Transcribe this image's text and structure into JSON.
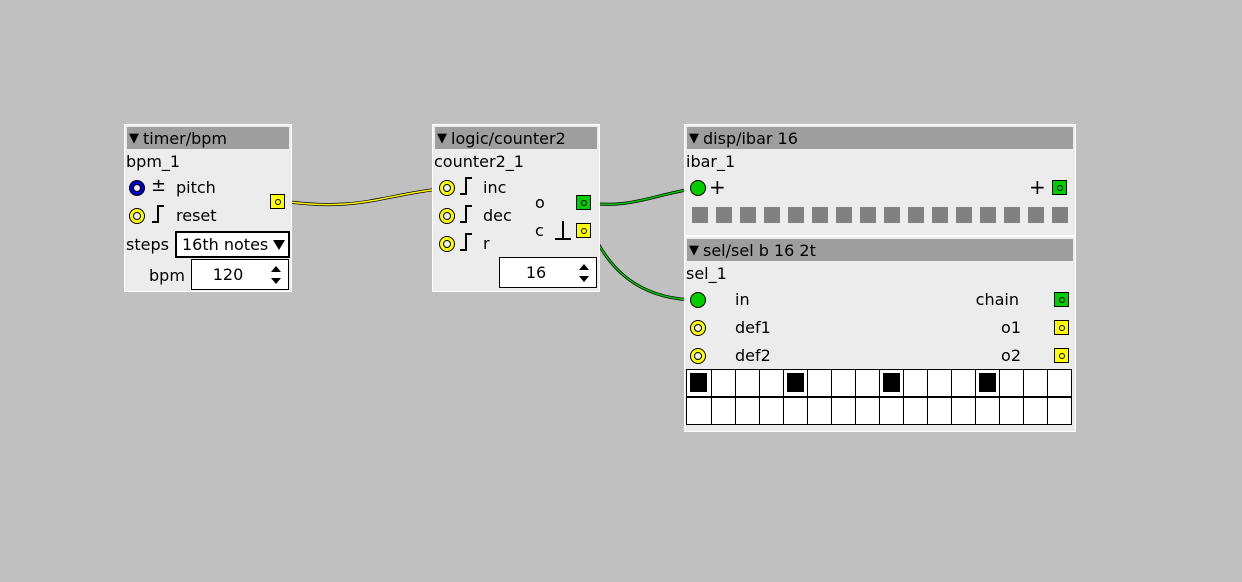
{
  "objects": {
    "timer": {
      "title": "timer/bpm",
      "instance": "bpm_1",
      "inlets": [
        {
          "symbol": "±",
          "label": "pitch"
        },
        {
          "label": "reset"
        }
      ],
      "steps_label": "steps",
      "steps_value": "16th notes",
      "bpm_label": "bpm",
      "bpm_value": "120"
    },
    "counter": {
      "title": "logic/counter2",
      "instance": "counter2_1",
      "inlets": [
        {
          "label": "inc"
        },
        {
          "label": "dec"
        },
        {
          "label": "r"
        }
      ],
      "outlets": [
        {
          "label": "o"
        },
        {
          "label": "c"
        }
      ],
      "value": "16"
    },
    "ibar": {
      "title": "disp/ibar 16",
      "instance": "ibar_1",
      "in_symbol": "+",
      "out_symbol": "+",
      "segments_lit": 0,
      "segments_total": 16
    },
    "sel": {
      "title": "sel/sel b 16 2t",
      "instance": "sel_1",
      "inlets": [
        {
          "label": "in"
        },
        {
          "label": "def1"
        },
        {
          "label": "def2"
        }
      ],
      "outlets": [
        {
          "label": "chain"
        },
        {
          "label": "o1"
        },
        {
          "label": "o2"
        }
      ],
      "row1": [
        1,
        0,
        0,
        0,
        1,
        0,
        0,
        0,
        1,
        0,
        0,
        0,
        1,
        0,
        0,
        0
      ],
      "row2": [
        0,
        0,
        0,
        0,
        0,
        0,
        0,
        0,
        0,
        0,
        0,
        0,
        0,
        0,
        0,
        0
      ]
    }
  },
  "colors": {
    "canvas": "#c0c0c0",
    "object_body": "#ececec",
    "header": "#9e9e9e",
    "bool_wire": "#ffff00",
    "int_wire": "#00cc00",
    "frac_inlet": "#0000cc"
  }
}
